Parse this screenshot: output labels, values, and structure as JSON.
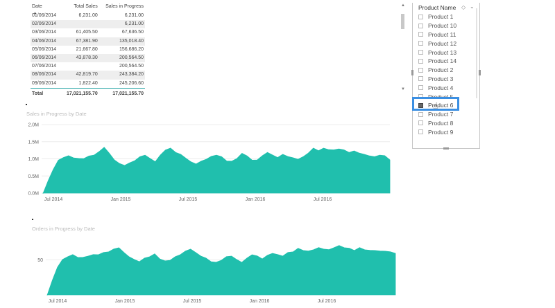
{
  "table": {
    "headers": [
      "Date",
      "Total Sales",
      "Sales in Progress"
    ],
    "rows": [
      [
        "01/06/2014",
        "6,231.00",
        "6,231.00"
      ],
      [
        "02/06/2014",
        "",
        "6,231.00"
      ],
      [
        "03/06/2014",
        "61,405.50",
        "67,636.50"
      ],
      [
        "04/06/2014",
        "67,381.90",
        "135,018.40"
      ],
      [
        "05/06/2014",
        "21,667.80",
        "156,686.20"
      ],
      [
        "06/06/2014",
        "43,878.30",
        "200,564.50"
      ],
      [
        "07/06/2014",
        "",
        "200,564.50"
      ],
      [
        "08/06/2014",
        "42,819.70",
        "243,384.20"
      ],
      [
        "09/06/2014",
        "1,822.40",
        "245,206.60"
      ]
    ],
    "total": [
      "Total",
      "17,021,155.70",
      "17,021,155.70"
    ]
  },
  "slicer": {
    "title": "Product Name",
    "items": [
      "Product 1",
      "Product 10",
      "Product 11",
      "Product 12",
      "Product 13",
      "Product 14",
      "Product 2",
      "Product 3",
      "Product 4",
      "Product 5",
      "Product 6",
      "Product 7",
      "Product 8",
      "Product 9"
    ],
    "selected": "Product 6"
  },
  "chart_data": [
    {
      "type": "area",
      "title": "Sales in Progress by Date",
      "color": "#20bfad",
      "x": [
        "Jul 2014",
        "Jan 2015",
        "Jul 2015",
        "Jan 2016",
        "Jul 2016"
      ],
      "y_ticks": [
        "2.0M",
        "1.5M",
        "1.0M",
        "0.5M",
        "0.0M"
      ],
      "ylim": [
        0,
        2.0
      ],
      "values": [
        0.0,
        0.35,
        0.7,
        0.95,
        1.05,
        1.08,
        1.04,
        1.0,
        1.02,
        1.07,
        1.12,
        1.2,
        1.35,
        1.15,
        0.98,
        0.85,
        0.82,
        0.87,
        0.96,
        1.05,
        1.12,
        1.0,
        0.93,
        1.1,
        1.27,
        1.3,
        1.2,
        1.12,
        1.03,
        0.9,
        0.86,
        0.92,
        1.0,
        1.06,
        1.12,
        1.05,
        0.95,
        0.92,
        1.02,
        1.15,
        1.1,
        0.95,
        0.98,
        1.08,
        1.2,
        1.1,
        1.05,
        1.12,
        1.08,
        1.02,
        1.0,
        1.05,
        1.18,
        1.3,
        1.25,
        1.3,
        1.28,
        1.25,
        1.3,
        1.25,
        1.2,
        1.22,
        1.18,
        1.12,
        1.1,
        1.05,
        1.12,
        1.08,
        0.98
      ]
    },
    {
      "type": "area",
      "title": "Orders in Progress by Date",
      "color": "#20bfad",
      "x": [
        "Jul 2014",
        "Jan 2015",
        "Jul 2015",
        "Jan 2016",
        "Jul 2016"
      ],
      "y_ticks": [
        "50"
      ],
      "ylim": [
        0,
        95
      ],
      "values": [
        0,
        20,
        40,
        50,
        55,
        57,
        54,
        53,
        56,
        57,
        58,
        60,
        62,
        65,
        68,
        60,
        55,
        50,
        48,
        52,
        55,
        58,
        52,
        48,
        50,
        54,
        58,
        62,
        66,
        60,
        56,
        52,
        48,
        46,
        50,
        54,
        56,
        50,
        47,
        52,
        58,
        55,
        52,
        56,
        60,
        57,
        56,
        60,
        62,
        66,
        64,
        62,
        65,
        67,
        66,
        64,
        68,
        70,
        68,
        66,
        64,
        67,
        65,
        63,
        64,
        62,
        63,
        61,
        60
      ]
    }
  ]
}
